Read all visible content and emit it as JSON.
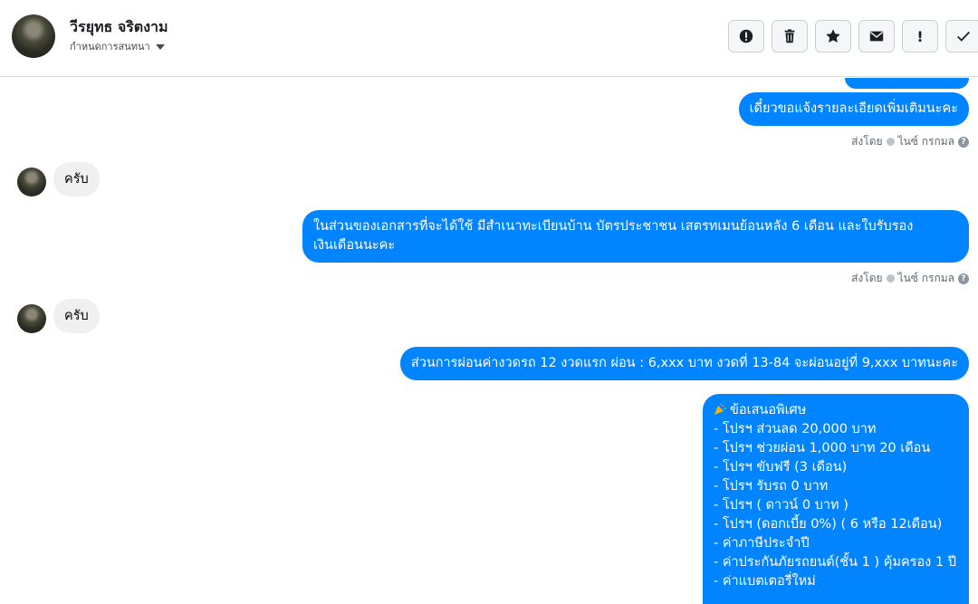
{
  "header": {
    "contact_name": "วีรยุทธ จริตงาม",
    "assign_label": "กำหนดการสนทนา",
    "toolbar": [
      {
        "name": "spam-icon",
        "label": "!"
      },
      {
        "name": "trash-icon",
        "label": ""
      },
      {
        "name": "star-icon",
        "label": ""
      },
      {
        "name": "envelope-icon",
        "label": ""
      },
      {
        "name": "follow-up-icon",
        "label": "!"
      },
      {
        "name": "check-icon",
        "label": ""
      }
    ]
  },
  "messages": {
    "out1": "เดี๋ยวขอแจ้งรายละเอียดเพิ่มเติมนะคะ",
    "sent_by_1": {
      "prefix": "ส่งโดย",
      "name": "ไนซ์ กรกมล"
    },
    "in1": "ครับ",
    "out2_line1": "ในส่วนของเอกสารที่จะได้ใช้  มีสำเนาทะเบียนบ้าน  บัตรประชาชน  เสตรทเมนย้อนหลัง 6 เดือน และใบรับรอง",
    "out2_line2": "เงินเดือนนะคะ",
    "sent_by_2": {
      "prefix": "ส่งโดย",
      "name": "ไนซ์ กรกมล"
    },
    "in2": "ครับ",
    "out3": "ส่วนการผ่อนค่างวดรถ 12 งวดแรก ผ่อน : 6,xxx บาท  งวดที่ 13-84 จะผ่อนอยู่ที่ 9,xxx บาทนะคะ",
    "offer_title": "ข้อเสนอพิเศษ",
    "offer_items": [
      "- โปรฯ ส่วนลด 20,000 บาท",
      "- โปรฯ ช่วยผ่อน 1,000 บาท 20 เดือน",
      "- โปรฯ ขับฟรี (3 เดือน)",
      "- โปรฯ รับรถ 0 บาท",
      "- โปรฯ ( ดาวน์ 0 บาท )",
      "- โปรฯ (ดอกเบี้ย 0%) ( 6 หรือ 12เดือน)",
      "- ค่าภาษีประจำปี",
      "- ค่าประกันภัยรถยนต์(ชั้น 1 ) คุ้มครอง 1 ปี",
      "- ค่าแบตเตอรี่ใหม่"
    ]
  },
  "colors": {
    "accent": "#0084ff",
    "incoming": "#f0f0f0"
  }
}
